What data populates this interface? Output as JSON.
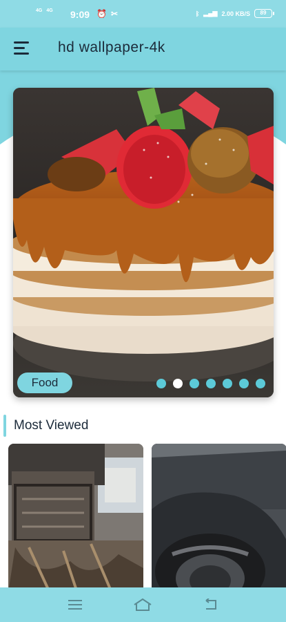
{
  "status_bar": {
    "net1": "4G",
    "net2": "4G",
    "time": "9:09",
    "right_info": "2.00 KB/S",
    "battery": "89"
  },
  "app_bar": {
    "title": "hd wallpaper-4k"
  },
  "carousel": {
    "category_label": "Food",
    "dot_count": 7,
    "active_dot": 1
  },
  "sections": {
    "most_viewed_title": "Most Viewed"
  },
  "colors": {
    "accent": "#7fd5e0",
    "dark_text": "#1c2b3a"
  }
}
